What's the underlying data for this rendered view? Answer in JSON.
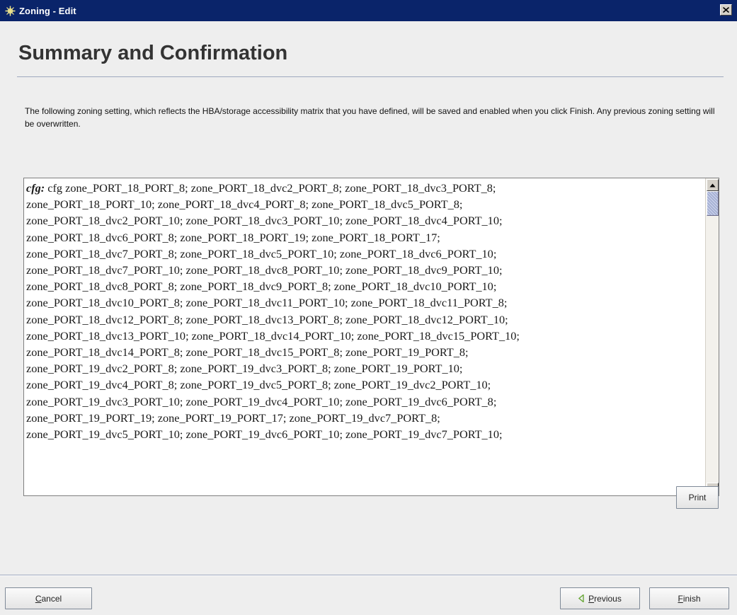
{
  "window": {
    "title": "Zoning - Edit",
    "close_symbol": "✕"
  },
  "page": {
    "heading": "Summary and Confirmation",
    "description": "The following zoning setting, which reflects the HBA/storage accessibility matrix that you have defined, will be saved and enabled when you click Finish. Any previous zoning setting will be overwritten."
  },
  "config": {
    "label": "cfg:",
    "lines": [
      " cfg zone_PORT_18_PORT_8; zone_PORT_18_dvc2_PORT_8; zone_PORT_18_dvc3_PORT_8;",
      "zone_PORT_18_PORT_10; zone_PORT_18_dvc4_PORT_8; zone_PORT_18_dvc5_PORT_8;",
      "zone_PORT_18_dvc2_PORT_10; zone_PORT_18_dvc3_PORT_10; zone_PORT_18_dvc4_PORT_10;",
      "zone_PORT_18_dvc6_PORT_8; zone_PORT_18_PORT_19; zone_PORT_18_PORT_17;",
      "zone_PORT_18_dvc7_PORT_8; zone_PORT_18_dvc5_PORT_10; zone_PORT_18_dvc6_PORT_10;",
      "zone_PORT_18_dvc7_PORT_10; zone_PORT_18_dvc8_PORT_10; zone_PORT_18_dvc9_PORT_10;",
      "zone_PORT_18_dvc8_PORT_8; zone_PORT_18_dvc9_PORT_8; zone_PORT_18_dvc10_PORT_10;",
      "zone_PORT_18_dvc10_PORT_8; zone_PORT_18_dvc11_PORT_10; zone_PORT_18_dvc11_PORT_8;",
      "zone_PORT_18_dvc12_PORT_8; zone_PORT_18_dvc13_PORT_8; zone_PORT_18_dvc12_PORT_10;",
      "zone_PORT_18_dvc13_PORT_10; zone_PORT_18_dvc14_PORT_10; zone_PORT_18_dvc15_PORT_10;",
      "zone_PORT_18_dvc14_PORT_8; zone_PORT_18_dvc15_PORT_8; zone_PORT_19_PORT_8;",
      "zone_PORT_19_dvc2_PORT_8; zone_PORT_19_dvc3_PORT_8; zone_PORT_19_PORT_10;",
      "zone_PORT_19_dvc4_PORT_8; zone_PORT_19_dvc5_PORT_8; zone_PORT_19_dvc2_PORT_10;",
      "zone_PORT_19_dvc3_PORT_10; zone_PORT_19_dvc4_PORT_10; zone_PORT_19_dvc6_PORT_8;",
      "zone_PORT_19_PORT_19; zone_PORT_19_PORT_17; zone_PORT_19_dvc7_PORT_8;",
      "zone_PORT_19_dvc5_PORT_10; zone_PORT_19_dvc6_PORT_10; zone_PORT_19_dvc7_PORT_10;"
    ]
  },
  "buttons": {
    "print": "Print",
    "cancel_first": "C",
    "cancel_rest": "ancel",
    "previous_first": "P",
    "previous_rest": "revious",
    "finish_first": "F",
    "finish_rest": "inish"
  },
  "icons": {
    "app": "zoning-icon",
    "close": "close-icon",
    "scroll_up": "arrow-up-icon",
    "scroll_down": "arrow-down-icon",
    "previous": "arrow-left-icon"
  },
  "colors": {
    "titlebar": "#0a246a",
    "previous_arrow": "#6aa83a"
  }
}
